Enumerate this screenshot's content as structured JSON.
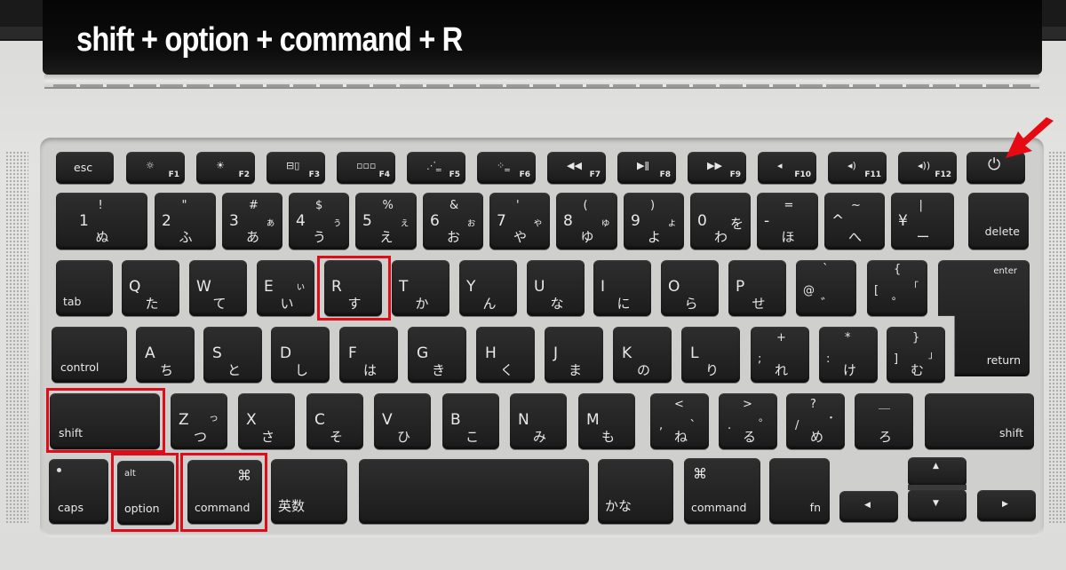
{
  "title": "shift + option + command + R",
  "highlight_color": "#e00c17",
  "arrow": {
    "icon": "red-arrow-icon",
    "target": "power"
  },
  "rows": {
    "function": [
      {
        "id": "esc",
        "label": "esc"
      },
      {
        "id": "f1",
        "icon": "☼",
        "num": "F1",
        "icon_name": "brightness-down-icon"
      },
      {
        "id": "f2",
        "icon": "☀",
        "num": "F2",
        "icon_name": "brightness-up-icon"
      },
      {
        "id": "f3",
        "icon": "⊟▯",
        "num": "F3",
        "icon_name": "mission-control-icon"
      },
      {
        "id": "f4",
        "icon": "▫▫▫",
        "num": "F4",
        "icon_name": "launchpad-icon"
      },
      {
        "id": "f5",
        "icon": "⋰‗",
        "num": "F5",
        "icon_name": "keyboard-light-down-icon"
      },
      {
        "id": "f6",
        "icon": "⁘‗",
        "num": "F6",
        "icon_name": "keyboard-light-up-icon"
      },
      {
        "id": "f7",
        "icon": "◀◀",
        "num": "F7",
        "icon_name": "rewind-icon"
      },
      {
        "id": "f8",
        "icon": "▶ǁ",
        "num": "F8",
        "icon_name": "play-pause-icon"
      },
      {
        "id": "f9",
        "icon": "▶▶",
        "num": "F9",
        "icon_name": "fast-forward-icon"
      },
      {
        "id": "f10",
        "icon": "◂",
        "num": "F10",
        "icon_name": "mute-icon"
      },
      {
        "id": "f11",
        "icon": "◂)",
        "num": "F11",
        "icon_name": "volume-down-icon"
      },
      {
        "id": "f12",
        "icon": "◂))",
        "num": "F12",
        "icon_name": "volume-up-icon"
      },
      {
        "id": "power",
        "icon": "⏻",
        "icon_name": "power-icon"
      }
    ],
    "number": [
      {
        "id": "1",
        "main": "1",
        "shift": "!",
        "kana": "ぬ",
        "kana_shift": ""
      },
      {
        "id": "2",
        "main": "2",
        "shift": "\"",
        "kana": "ふ",
        "kana_shift": ""
      },
      {
        "id": "3",
        "main": "3",
        "shift": "#",
        "kana": "あ",
        "kana_shift": "ぁ"
      },
      {
        "id": "4",
        "main": "4",
        "shift": "$",
        "kana": "う",
        "kana_shift": "ぅ"
      },
      {
        "id": "5",
        "main": "5",
        "shift": "%",
        "kana": "え",
        "kana_shift": "ぇ"
      },
      {
        "id": "6",
        "main": "6",
        "shift": "&",
        "kana": "お",
        "kana_shift": "ぉ"
      },
      {
        "id": "7",
        "main": "7",
        "shift": "'",
        "kana": "や",
        "kana_shift": "ゃ"
      },
      {
        "id": "8",
        "main": "8",
        "shift": "(",
        "kana": "ゆ",
        "kana_shift": "ゅ"
      },
      {
        "id": "9",
        "main": "9",
        "shift": ")",
        "kana": "よ",
        "kana_shift": "ょ"
      },
      {
        "id": "0",
        "main": "0",
        "shift": "",
        "kana": "わ",
        "kana_shift": "を"
      },
      {
        "id": "minus",
        "main": "-",
        "shift": "=",
        "kana": "ほ",
        "kana_shift": ""
      },
      {
        "id": "caret",
        "main": "^",
        "shift": "~",
        "kana": "へ",
        "kana_shift": ""
      },
      {
        "id": "yen",
        "main": "¥",
        "shift": "|",
        "kana": "ー",
        "kana_shift": ""
      },
      {
        "id": "delete",
        "label": "delete"
      }
    ],
    "qwerty": [
      {
        "id": "tab",
        "label": "tab"
      },
      {
        "id": "q",
        "main": "Q",
        "kana": "た"
      },
      {
        "id": "w",
        "main": "W",
        "kana": "て"
      },
      {
        "id": "e",
        "main": "E",
        "kana": "い",
        "kana_shift": "ぃ"
      },
      {
        "id": "r",
        "main": "R",
        "kana": "す"
      },
      {
        "id": "t",
        "main": "T",
        "kana": "か"
      },
      {
        "id": "y",
        "main": "Y",
        "kana": "ん"
      },
      {
        "id": "u",
        "main": "U",
        "kana": "な"
      },
      {
        "id": "i",
        "main": "I",
        "kana": "に"
      },
      {
        "id": "o",
        "main": "O",
        "kana": "ら"
      },
      {
        "id": "p",
        "main": "P",
        "kana": "せ"
      },
      {
        "id": "at",
        "main": "@",
        "shift": "`",
        "kana": "゛"
      },
      {
        "id": "bracket-open",
        "main": "[",
        "shift": "{",
        "kana": "゜",
        "kana_shift": "「"
      },
      {
        "id": "enter",
        "label_top": "enter",
        "label_bottom": "return"
      }
    ],
    "home": [
      {
        "id": "control",
        "label": "control"
      },
      {
        "id": "a",
        "main": "A",
        "kana": "ち"
      },
      {
        "id": "s",
        "main": "S",
        "kana": "と"
      },
      {
        "id": "d",
        "main": "D",
        "kana": "し"
      },
      {
        "id": "f",
        "main": "F",
        "kana": "は"
      },
      {
        "id": "g",
        "main": "G",
        "kana": "き"
      },
      {
        "id": "h",
        "main": "H",
        "kana": "く"
      },
      {
        "id": "j",
        "main": "J",
        "kana": "ま"
      },
      {
        "id": "k",
        "main": "K",
        "kana": "の"
      },
      {
        "id": "l",
        "main": "L",
        "kana": "り"
      },
      {
        "id": "semicolon",
        "main": ";",
        "shift": "+",
        "kana": "れ"
      },
      {
        "id": "colon",
        "main": ":",
        "shift": "*",
        "kana": "け"
      },
      {
        "id": "bracket-close",
        "main": "]",
        "shift": "}",
        "kana": "む",
        "kana_shift": "」"
      }
    ],
    "bottom_alpha": [
      {
        "id": "shift-left",
        "label": "shift"
      },
      {
        "id": "z",
        "main": "Z",
        "kana": "つ",
        "kana_shift": "っ"
      },
      {
        "id": "x",
        "main": "X",
        "kana": "さ"
      },
      {
        "id": "c",
        "main": "C",
        "kana": "そ"
      },
      {
        "id": "v",
        "main": "V",
        "kana": "ひ"
      },
      {
        "id": "b",
        "main": "B",
        "kana": "こ"
      },
      {
        "id": "n",
        "main": "N",
        "kana": "み"
      },
      {
        "id": "m",
        "main": "M",
        "kana": "も"
      },
      {
        "id": "comma",
        "main": ",",
        "shift": "<",
        "kana": "ね",
        "kana_shift": "、"
      },
      {
        "id": "period",
        "main": ".",
        "shift": ">",
        "kana": "る",
        "kana_shift": "。"
      },
      {
        "id": "slash",
        "main": "/",
        "shift": "?",
        "kana": "め",
        "kana_shift": "・"
      },
      {
        "id": "underscore",
        "main": "",
        "shift": "＿",
        "kana": "ろ"
      },
      {
        "id": "shift-right",
        "label": "shift"
      }
    ],
    "space": [
      {
        "id": "caps",
        "label": "caps"
      },
      {
        "id": "option",
        "label_top": "alt",
        "label": "option"
      },
      {
        "id": "command-left",
        "label_top": "⌘",
        "label": "command"
      },
      {
        "id": "eisu",
        "label": "英数"
      },
      {
        "id": "space",
        "label": ""
      },
      {
        "id": "kana",
        "label": "かな"
      },
      {
        "id": "command-right",
        "label_top": "⌘",
        "label": "command"
      },
      {
        "id": "fn",
        "label": "fn"
      },
      {
        "id": "arrow-left",
        "label": "◀"
      },
      {
        "id": "arrow-up",
        "label": "▲"
      },
      {
        "id": "arrow-down",
        "label": "▼"
      },
      {
        "id": "arrow-right",
        "label": "▶"
      }
    ]
  },
  "highlighted_keys": [
    "shift-left",
    "option",
    "command-left",
    "r"
  ]
}
